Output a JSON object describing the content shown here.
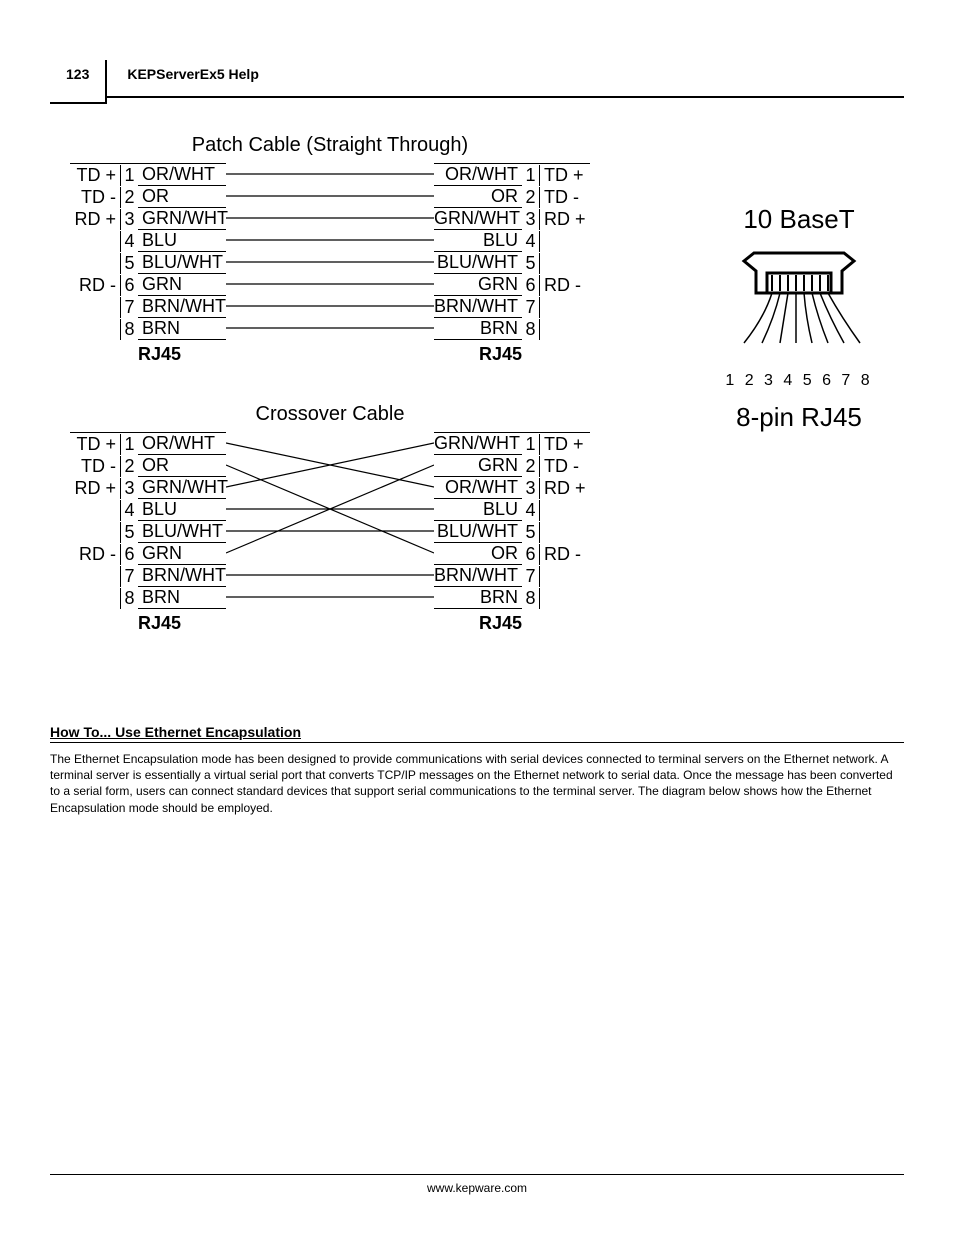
{
  "header": {
    "page_number": "123",
    "title": "KEPServerEx5 Help"
  },
  "diagram": {
    "patch_title": "Patch Cable (Straight Through)",
    "crossover_title": "Crossover Cable",
    "connector_label": "RJ45",
    "right_panel": {
      "title1": "10 BaseT",
      "pin_numbers": "1 2 3 4 5 6 7 8",
      "title2": "8-pin RJ45"
    },
    "patch": {
      "left": [
        {
          "label": "TD +",
          "num": "1",
          "color": "OR/WHT"
        },
        {
          "label": "TD -",
          "num": "2",
          "color": "OR"
        },
        {
          "label": "RD +",
          "num": "3",
          "color": "GRN/WHT"
        },
        {
          "label": "",
          "num": "4",
          "color": "BLU"
        },
        {
          "label": "",
          "num": "5",
          "color": "BLU/WHT"
        },
        {
          "label": "RD -",
          "num": "6",
          "color": "GRN"
        },
        {
          "label": "",
          "num": "7",
          "color": "BRN/WHT"
        },
        {
          "label": "",
          "num": "8",
          "color": "BRN"
        }
      ],
      "right": [
        {
          "label": "TD +",
          "num": "1",
          "color": "OR/WHT"
        },
        {
          "label": "TD -",
          "num": "2",
          "color": "OR"
        },
        {
          "label": "RD +",
          "num": "3",
          "color": "GRN/WHT"
        },
        {
          "label": "",
          "num": "4",
          "color": "BLU"
        },
        {
          "label": "",
          "num": "5",
          "color": "BLU/WHT"
        },
        {
          "label": "RD -",
          "num": "6",
          "color": "GRN"
        },
        {
          "label": "",
          "num": "7",
          "color": "BRN/WHT"
        },
        {
          "label": "",
          "num": "8",
          "color": "BRN"
        }
      ]
    },
    "crossover": {
      "left": [
        {
          "label": "TD +",
          "num": "1",
          "color": "OR/WHT"
        },
        {
          "label": "TD -",
          "num": "2",
          "color": "OR"
        },
        {
          "label": "RD +",
          "num": "3",
          "color": "GRN/WHT"
        },
        {
          "label": "",
          "num": "4",
          "color": "BLU"
        },
        {
          "label": "",
          "num": "5",
          "color": "BLU/WHT"
        },
        {
          "label": "RD -",
          "num": "6",
          "color": "GRN"
        },
        {
          "label": "",
          "num": "7",
          "color": "BRN/WHT"
        },
        {
          "label": "",
          "num": "8",
          "color": "BRN"
        }
      ],
      "right": [
        {
          "label": "TD +",
          "num": "1",
          "color": "GRN/WHT"
        },
        {
          "label": "TD -",
          "num": "2",
          "color": "GRN"
        },
        {
          "label": "RD +",
          "num": "3",
          "color": "OR/WHT"
        },
        {
          "label": "",
          "num": "4",
          "color": "BLU"
        },
        {
          "label": "",
          "num": "5",
          "color": "BLU/WHT"
        },
        {
          "label": "RD -",
          "num": "6",
          "color": "OR"
        },
        {
          "label": "",
          "num": "7",
          "color": "BRN/WHT"
        },
        {
          "label": "",
          "num": "8",
          "color": "BRN"
        }
      ]
    }
  },
  "section": {
    "heading": "How To... Use Ethernet Encapsulation",
    "body": "The Ethernet Encapsulation mode has been designed to provide communications with serial devices connected to terminal servers on the Ethernet network. A terminal server is essentially a virtual serial port that converts TCP/IP messages on the Ethernet network to serial data. Once the message has been converted to a serial form, users can connect standard devices that support serial communications to the terminal server. The diagram below shows how the Ethernet Encapsulation mode should be employed."
  },
  "footer": "www.kepware.com"
}
